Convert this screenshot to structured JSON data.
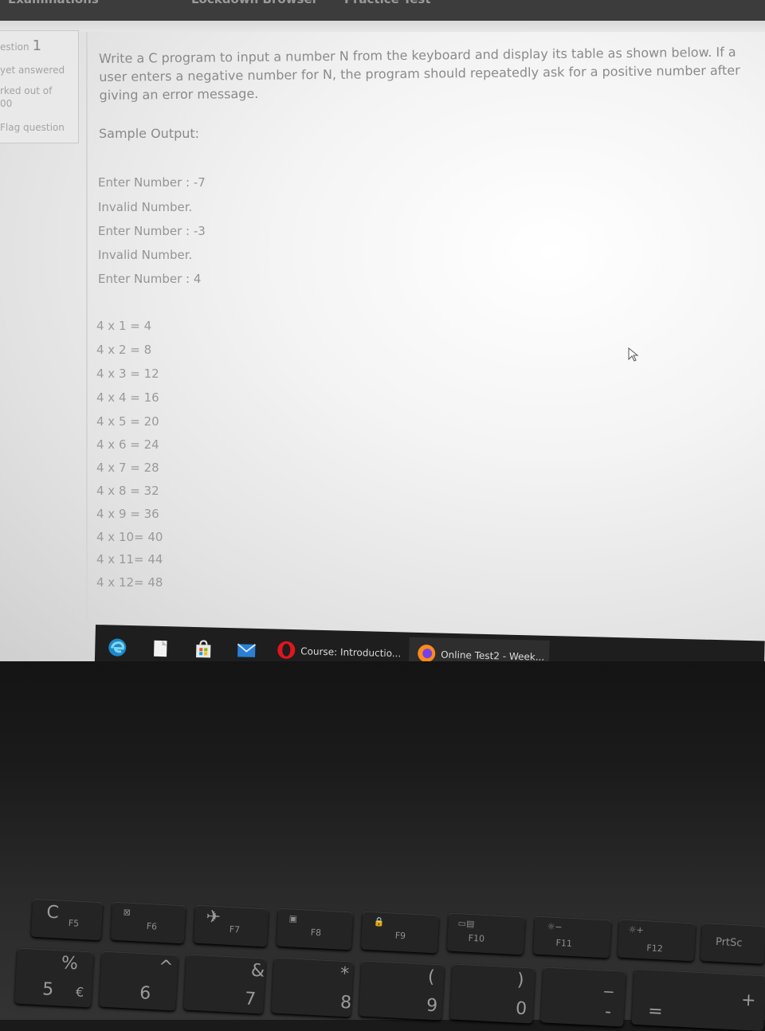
{
  "browser": {
    "top_tabs": [
      "Examinations",
      "Lockdown Browser",
      "Practice Test"
    ]
  },
  "question_info": {
    "number_label": "estion",
    "number": "1",
    "status": "yet answered",
    "marks_label": "rked out of",
    "marks_value": "00",
    "flag": "Flag question"
  },
  "question": {
    "text": "Write a C program to input a number N from the keyboard and display its table as shown below. If a user enters a negative number for N, the program should repeatedly ask for a positive number after giving an error message.",
    "sample_label": "Sample Output:",
    "io_lines": [
      "Enter Number : -7",
      "Invalid Number.",
      "Enter Number : -3",
      "Invalid Number.",
      "Enter Number : 4"
    ],
    "table_lines": [
      "4 x 1  = 4",
      "4 x 2  = 8",
      "4 x 3  = 12",
      "4 x 4  = 16",
      "4 x 5  = 20",
      "4 x 6  = 24",
      "4 x 7  = 28",
      "4 x 8  = 32",
      "4 x 9  = 36",
      "4 x 10= 40",
      "4 x 11= 44",
      "4 x 12= 48"
    ]
  },
  "taskbar": {
    "icons": [
      "edge-icon",
      "file-explorer-icon",
      "store-icon",
      "mail-icon"
    ],
    "apps": [
      {
        "label": "Course: Introductio...",
        "icon": "opera-icon"
      },
      {
        "label": "Online Test2 - Week...",
        "icon": "firefox-icon"
      }
    ]
  },
  "keyboard": {
    "fn_keys": [
      "F5",
      "F6",
      "F7",
      "F8",
      "F9",
      "F10",
      "F11",
      "F12",
      "PrtSc"
    ],
    "num_keys": [
      {
        "top": "%",
        "bottom": "5",
        "alt": "€"
      },
      {
        "top": "^",
        "bottom": "6"
      },
      {
        "top": "&",
        "bottom": "7"
      },
      {
        "top": "*",
        "bottom": "8"
      },
      {
        "top": "(",
        "bottom": "9"
      },
      {
        "top": ")",
        "bottom": "0"
      },
      {
        "top": "_",
        "bottom": "-"
      },
      {
        "top": "+",
        "bottom": "="
      }
    ]
  },
  "colors": {
    "screen_bg": "#f4f4f4",
    "text": "#8a8a8a",
    "taskbar": "#1e1e1e",
    "keyboard": "#242424"
  }
}
